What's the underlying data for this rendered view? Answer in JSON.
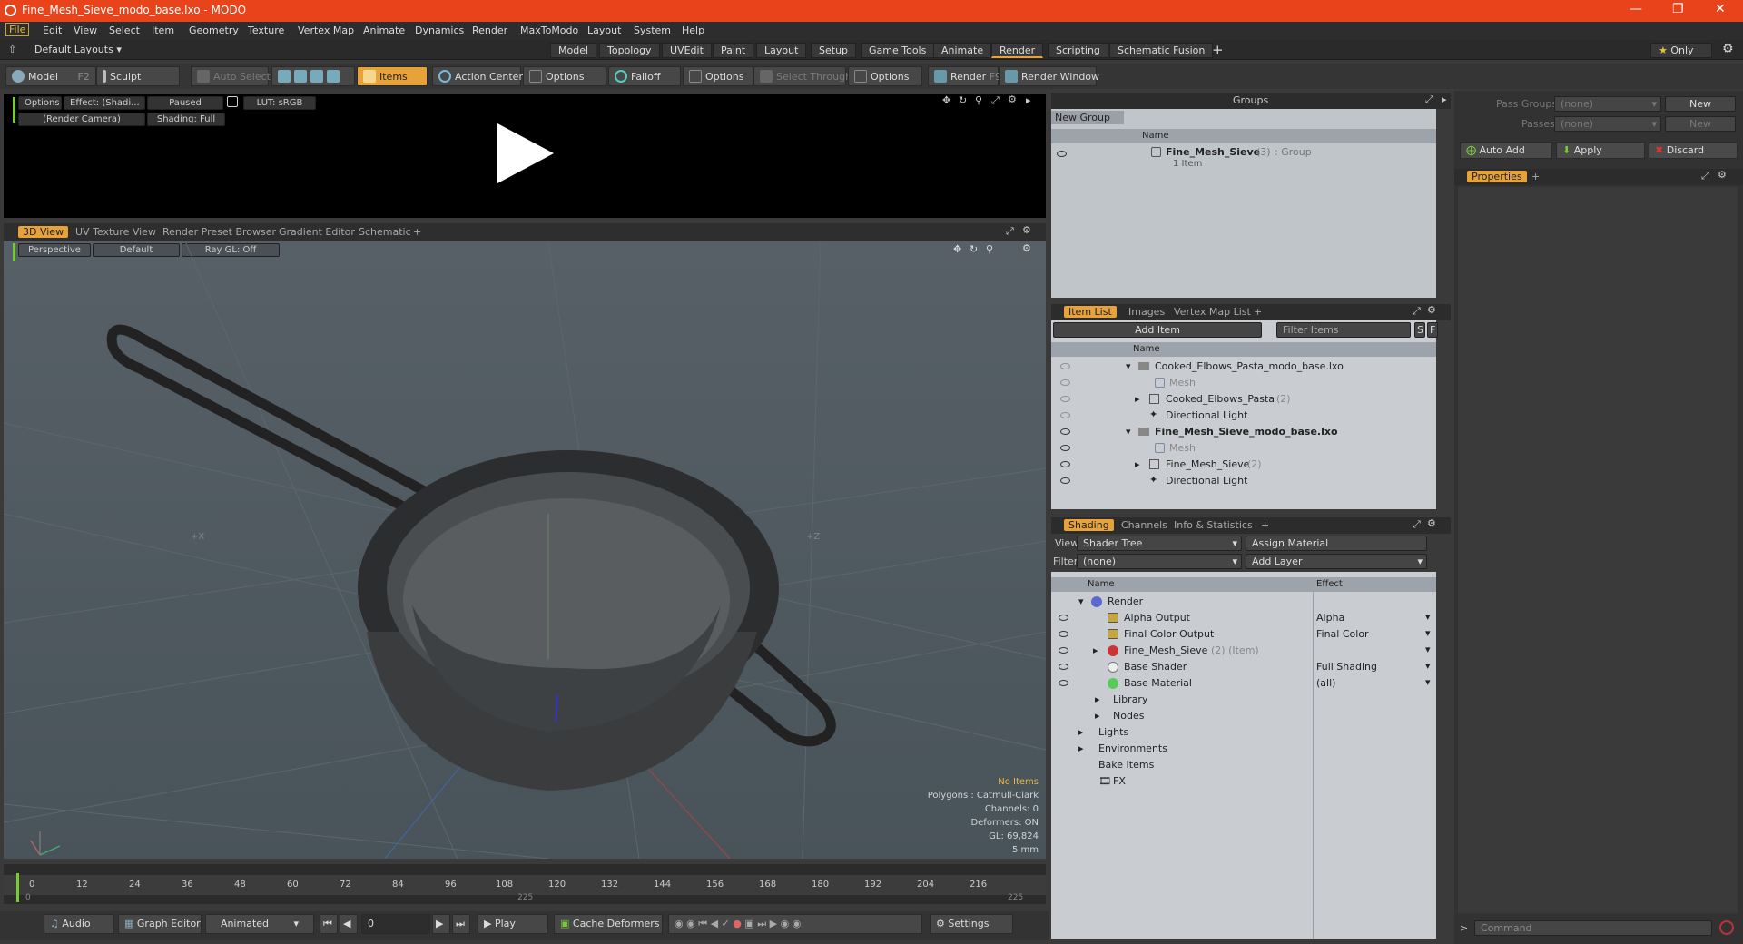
{
  "window": {
    "title": "Fine_Mesh_Sieve_modo_base.lxo - MODO"
  },
  "menu": [
    "File",
    "Edit",
    "View",
    "Select",
    "Item",
    "Geometry",
    "Texture",
    "Vertex Map",
    "Animate",
    "Dynamics",
    "Render",
    "MaxToModo",
    "Layout",
    "System",
    "Help"
  ],
  "layout_bar": {
    "preset": "Default Layouts",
    "tabs": [
      "Model",
      "Topology",
      "UVEdit",
      "Paint",
      "Layout",
      "Setup",
      "Game Tools",
      "Animate",
      "Render",
      "Scripting",
      "Schematic Fusion"
    ],
    "active_tab": "Render",
    "only_label": "Only"
  },
  "toolbar": {
    "model": "Model",
    "model_key": "F2",
    "sculpt": "Sculpt",
    "auto_select": "Auto Select",
    "items": "Items",
    "action_center": "Action Center",
    "options1": "Options",
    "falloff": "Falloff",
    "options2": "Options",
    "select_through": "Select Through",
    "options3": "Options",
    "render": "Render",
    "render_key": "F9",
    "render_window": "Render Window"
  },
  "render_view": {
    "options": "Options",
    "effect": "Effect: (Shadi...",
    "paused": "Paused",
    "lut": "LUT: sRGB",
    "camera": "(Render Camera)",
    "shading": "Shading: Full"
  },
  "view_tabs": [
    "3D View",
    "UV Texture View",
    "Render Preset Browser",
    "Gradient Editor",
    "Schematic"
  ],
  "viewport": {
    "perspective": "Perspective",
    "default": "Default",
    "raygl": "Ray GL: Off",
    "axis_x": "+X",
    "axis_z": "+Z",
    "stats": {
      "no_items": "No Items",
      "polygons": "Polygons : Catmull-Clark",
      "channels": "Channels: 0",
      "deformers": "Deformers: ON",
      "gl": "GL: 69,824",
      "unit": "5 mm"
    }
  },
  "timeline": {
    "ticks": [
      "0",
      "12",
      "24",
      "36",
      "48",
      "60",
      "72",
      "84",
      "96",
      "108",
      "120",
      "132",
      "144",
      "156",
      "168",
      "180",
      "192",
      "204",
      "216"
    ],
    "sub_start": "0",
    "sub_mid": "225",
    "sub_end": "225"
  },
  "bottom": {
    "audio": "Audio",
    "graph_editor": "Graph Editor",
    "animated": "Animated",
    "frame": "0",
    "play": "Play",
    "cache_deformers": "Cache Deformers",
    "settings": "Settings"
  },
  "groups": {
    "title": "Groups",
    "new_group": "New Group",
    "col_name": "Name",
    "item_name": "Fine_Mesh_Sieve",
    "item_count": "(3)",
    "item_type": ": Group",
    "item_sub": "1 Item"
  },
  "item_list": {
    "tabs": [
      "Item List",
      "Images",
      "Vertex Map List"
    ],
    "add_item": "Add Item",
    "filter": "Filter Items",
    "s": "S",
    "f": "F",
    "col_name": "Name",
    "rows": [
      {
        "label": "Cooked_Elbows_Pasta_modo_base.lxo",
        "suffix": ""
      },
      {
        "label": "Mesh",
        "suffix": ""
      },
      {
        "label": "Cooked_Elbows_Pasta",
        "suffix": "(2)"
      },
      {
        "label": "Directional Light",
        "suffix": ""
      },
      {
        "label": "Fine_Mesh_Sieve_modo_base.lxo",
        "suffix": ""
      },
      {
        "label": "Mesh",
        "suffix": ""
      },
      {
        "label": "Fine_Mesh_Sieve",
        "suffix": "(2)"
      },
      {
        "label": "Directional Light",
        "suffix": ""
      }
    ]
  },
  "shading": {
    "tabs": [
      "Shading",
      "Channels",
      "Info & Statistics"
    ],
    "view_label": "View",
    "view_value": "Shader Tree",
    "assign": "Assign Material",
    "filter_label": "Filter",
    "filter_value": "(none)",
    "add_layer": "Add Layer",
    "col_name": "Name",
    "col_effect": "Effect",
    "rows": [
      {
        "label": "Render",
        "effect": ""
      },
      {
        "label": "Alpha Output",
        "effect": "Alpha"
      },
      {
        "label": "Final Color Output",
        "effect": "Final Color"
      },
      {
        "label": "Fine_Mesh_Sieve",
        "suffix": "(2) (Item)",
        "effect": ""
      },
      {
        "label": "Base Shader",
        "effect": "Full Shading"
      },
      {
        "label": "Base Material",
        "effect": "(all)"
      },
      {
        "label": "Library",
        "effect": ""
      },
      {
        "label": "Nodes",
        "effect": ""
      },
      {
        "label": "Lights",
        "effect": ""
      },
      {
        "label": "Environments",
        "effect": ""
      },
      {
        "label": "Bake Items",
        "effect": ""
      },
      {
        "label": "FX",
        "effect": ""
      }
    ]
  },
  "right": {
    "pass_groups": "Pass Groups",
    "passes": "Passes",
    "none1": "(none)",
    "none2": "(none)",
    "new1": "New",
    "new2": "New",
    "auto_add": "Auto Add",
    "apply": "Apply",
    "discard": "Discard",
    "properties": "Properties",
    "command": "Command"
  }
}
